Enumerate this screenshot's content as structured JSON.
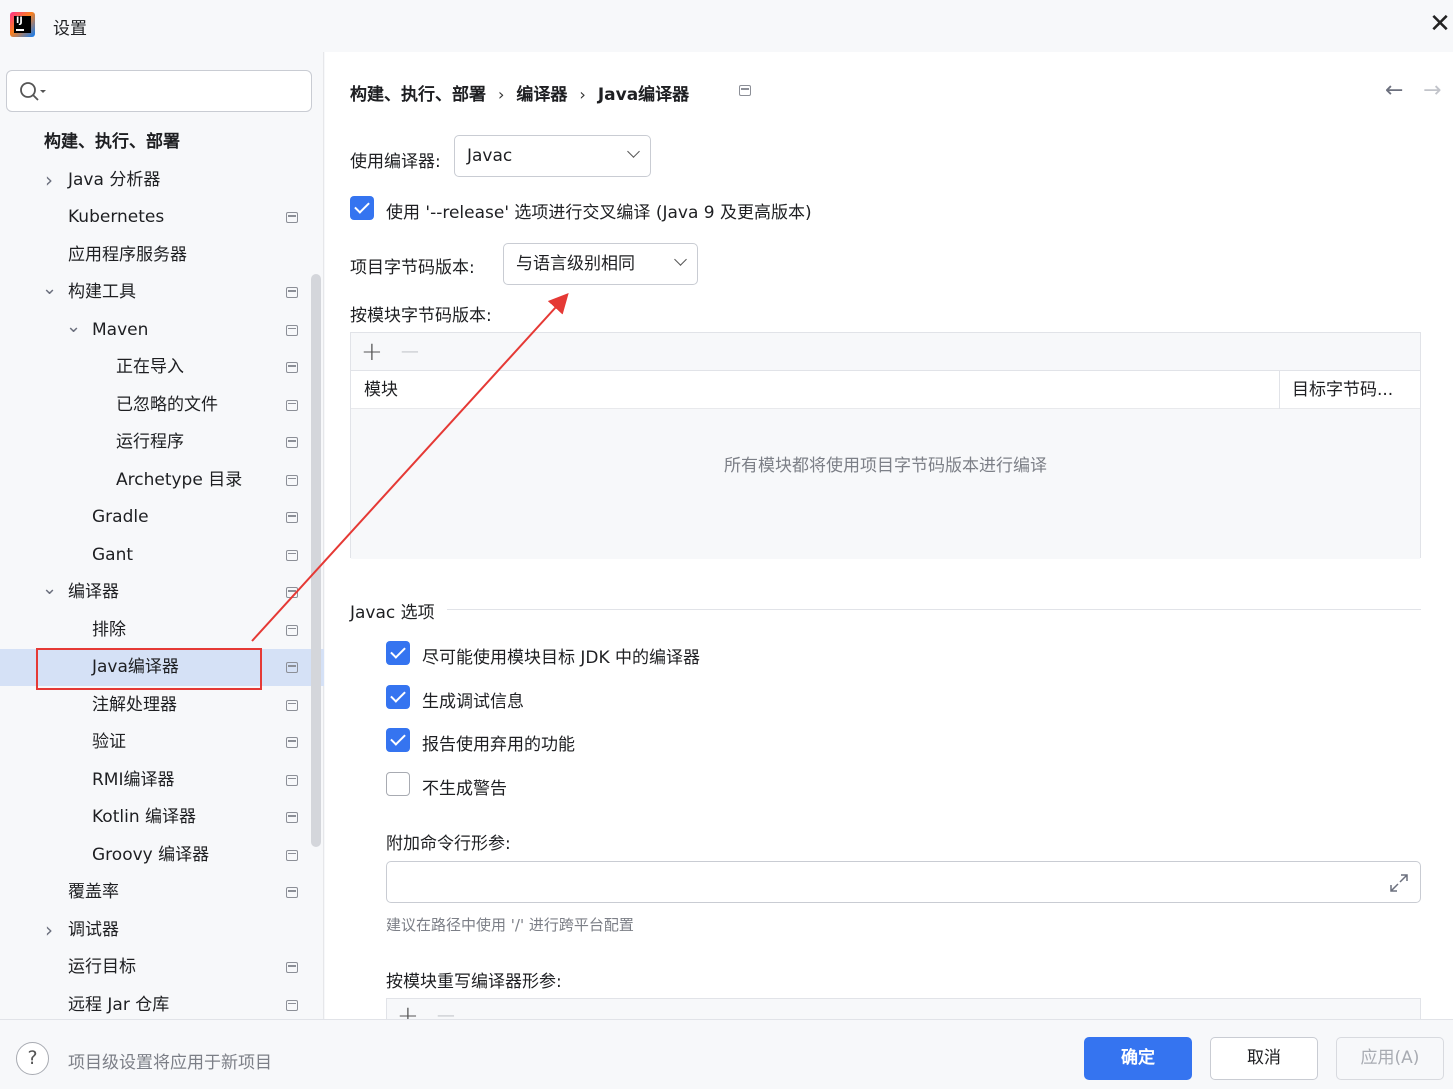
{
  "window": {
    "title": "设置",
    "close_label": "✕"
  },
  "search": {
    "placeholder": "",
    "value": ""
  },
  "sidebar": {
    "items": [
      {
        "label": "构建、执行、部署",
        "level": 0,
        "expand": "none",
        "project": false,
        "header": true
      },
      {
        "label": "Java 分析器",
        "level": 1,
        "expand": "collapsed",
        "project": false
      },
      {
        "label": "Kubernetes",
        "level": 1,
        "expand": "none",
        "project": true
      },
      {
        "label": "应用程序服务器",
        "level": 1,
        "expand": "none",
        "project": false
      },
      {
        "label": "构建工具",
        "level": 1,
        "expand": "expanded",
        "project": true
      },
      {
        "label": "Maven",
        "level": 2,
        "expand": "expanded",
        "project": true
      },
      {
        "label": "正在导入",
        "level": 3,
        "expand": "none",
        "project": true
      },
      {
        "label": "已忽略的文件",
        "level": 3,
        "expand": "none",
        "project": true
      },
      {
        "label": "运行程序",
        "level": 3,
        "expand": "none",
        "project": true
      },
      {
        "label": "Archetype 目录",
        "level": 3,
        "expand": "none",
        "project": true
      },
      {
        "label": "Gradle",
        "level": 2,
        "expand": "none",
        "project": true
      },
      {
        "label": "Gant",
        "level": 2,
        "expand": "none",
        "project": true
      },
      {
        "label": "编译器",
        "level": 1,
        "expand": "expanded",
        "project": true
      },
      {
        "label": "排除",
        "level": 2,
        "expand": "none",
        "project": true
      },
      {
        "label": "Java编译器",
        "level": 2,
        "expand": "none",
        "project": true,
        "selected": true
      },
      {
        "label": "注解处理器",
        "level": 2,
        "expand": "none",
        "project": true
      },
      {
        "label": "验证",
        "level": 2,
        "expand": "none",
        "project": true
      },
      {
        "label": "RMI编译器",
        "level": 2,
        "expand": "none",
        "project": true
      },
      {
        "label": "Kotlin 编译器",
        "level": 2,
        "expand": "none",
        "project": true
      },
      {
        "label": "Groovy 编译器",
        "level": 2,
        "expand": "none",
        "project": true
      },
      {
        "label": "覆盖率",
        "level": 1,
        "expand": "none",
        "project": true
      },
      {
        "label": "调试器",
        "level": 1,
        "expand": "collapsed",
        "project": false
      },
      {
        "label": "运行目标",
        "level": 1,
        "expand": "none",
        "project": true
      },
      {
        "label": "远程 Jar 仓库",
        "level": 1,
        "expand": "none",
        "project": true
      }
    ]
  },
  "breadcrumb": {
    "items": [
      "构建、执行、部署",
      "编译器",
      "Java编译器"
    ],
    "separator": "›"
  },
  "nav": {
    "back": "←",
    "forward": "→"
  },
  "compiler": {
    "use_compiler_label": "使用编译器:",
    "use_compiler_value": "Javac",
    "release_option_label": "使用 '--release' 选项进行交叉编译 (Java 9 及更高版本)",
    "release_option_checked": true,
    "bytecode_label": "项目字节码版本:",
    "bytecode_value": "与语言级别相同",
    "per_module_label": "按模块字节码版本:"
  },
  "module_table": {
    "add": "+",
    "remove": "−",
    "columns": [
      "模块",
      "目标字节码..."
    ],
    "empty_text": "所有模块都将使用项目字节码版本进行编译"
  },
  "javac": {
    "group_title": "Javac 选项",
    "options": [
      {
        "label": "尽可能使用模块目标 JDK 中的编译器",
        "checked": true
      },
      {
        "label": "生成调试信息",
        "checked": true
      },
      {
        "label": "报告使用弃用的功能",
        "checked": true
      },
      {
        "label": "不生成警告",
        "checked": false
      }
    ],
    "extra_args_label": "附加命令行形参:",
    "extra_args_value": "",
    "hint": "建议在路径中使用 '/' 进行跨平台配置",
    "override_label": "按模块重写编译器形参:"
  },
  "footer": {
    "help": "?",
    "note": "项目级设置将应用于新项目",
    "ok": "确定",
    "cancel": "取消",
    "apply": "应用(A)"
  },
  "colors": {
    "accent": "#3574f0",
    "selection": "#d5e1f6",
    "annotation": "#e53935"
  }
}
